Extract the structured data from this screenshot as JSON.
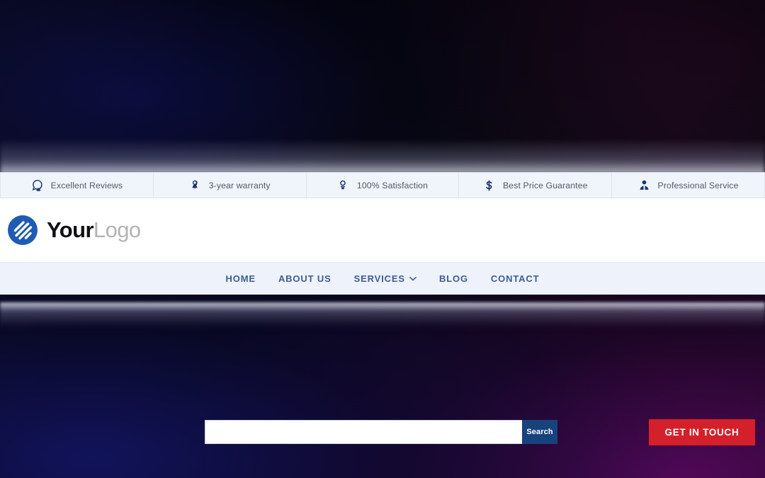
{
  "topbar": {
    "items": [
      {
        "icon": "comment-bubble-icon",
        "label": "Excellent Reviews"
      },
      {
        "icon": "ribbon-award-icon",
        "label": "3-year warranty"
      },
      {
        "icon": "medal-icon",
        "label": "100% Satisfaction"
      },
      {
        "icon": "dollar-sign-icon",
        "label": "Best Price Guarantee"
      },
      {
        "icon": "user-person-icon",
        "label": "Professional Service"
      }
    ]
  },
  "brand": {
    "icon": "circle-slash-logo-icon",
    "name_bold": "Your",
    "name_light": "Logo"
  },
  "search": {
    "value": "",
    "placeholder": "",
    "button_label": "Search"
  },
  "cta": {
    "label": "GET IN TOUCH"
  },
  "nav": {
    "items": [
      {
        "label": "HOME",
        "has_dropdown": false
      },
      {
        "label": "ABOUT US",
        "has_dropdown": false
      },
      {
        "label": "SERVICES",
        "has_dropdown": true
      },
      {
        "label": "BLOG",
        "has_dropdown": false
      },
      {
        "label": "CONTACT",
        "has_dropdown": false
      }
    ]
  },
  "colors": {
    "accent_red": "#d4202a",
    "accent_navy": "#17427c",
    "logo_blue": "#1f5bb5",
    "nav_text": "#3f5c93",
    "topbar_bg": "#f0f4fb",
    "navbar_bg": "#eef2fb"
  }
}
